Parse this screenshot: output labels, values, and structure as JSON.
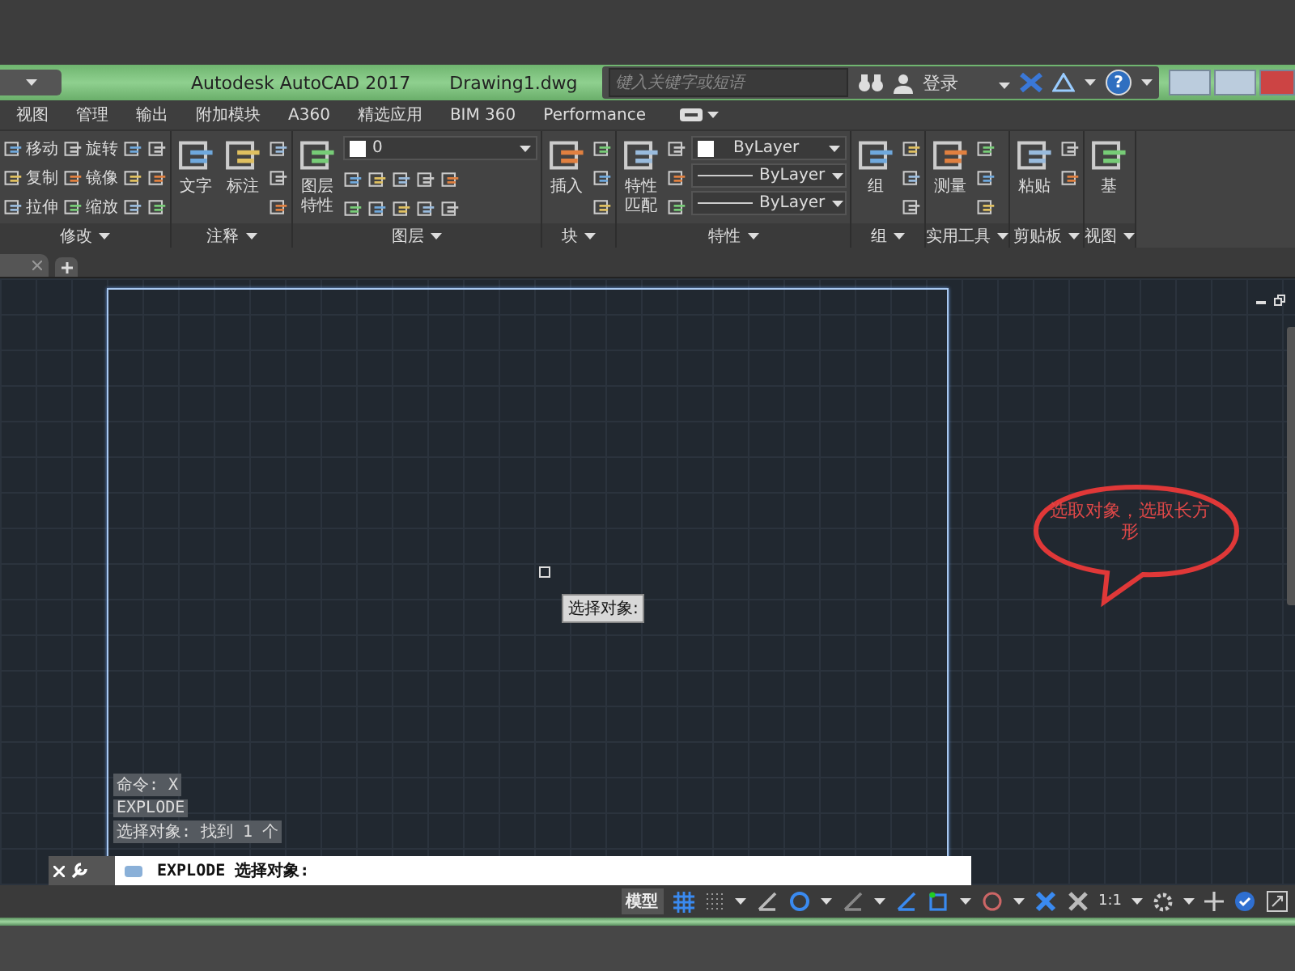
{
  "title_bar": {
    "app_title": "Autodesk AutoCAD 2017",
    "document": "Drawing1.dwg",
    "search": {
      "placeholder": "键入关键字或短语"
    },
    "sign_in": "登录",
    "help": "?"
  },
  "ribbon_tabs": [
    "视图",
    "管理",
    "输出",
    "附加模块",
    "A360",
    "精选应用",
    "BIM 360",
    "Performance"
  ],
  "ribbon_panels": [
    {
      "title": "修改",
      "columns": [
        [
          {
            "kind": "small",
            "label": "移动"
          },
          {
            "kind": "small",
            "label": "复制"
          },
          {
            "kind": "small",
            "label": "拉伸"
          }
        ],
        [
          {
            "kind": "small",
            "label": "旋转"
          },
          {
            "kind": "small",
            "label": "镜像"
          },
          {
            "kind": "small",
            "label": "缩放"
          }
        ],
        [
          {
            "kind": "icon"
          },
          {
            "kind": "icon"
          },
          {
            "kind": "icon"
          }
        ],
        [
          {
            "kind": "icon"
          },
          {
            "kind": "icon"
          },
          {
            "kind": "icon"
          }
        ]
      ]
    },
    {
      "title": "注释",
      "columns": [
        [
          {
            "kind": "large",
            "label": "文字"
          }
        ],
        [
          {
            "kind": "large",
            "label": "标注"
          }
        ],
        [
          {
            "kind": "icon"
          },
          {
            "kind": "icon"
          },
          {
            "kind": "icon"
          }
        ]
      ]
    },
    {
      "title": "图层",
      "columns": [
        [
          {
            "kind": "large",
            "label": "图层特性"
          }
        ],
        [
          {
            "kind": "layer-select",
            "value": "0"
          },
          [
            {
              "kind": "icon"
            },
            {
              "kind": "icon"
            },
            {
              "kind": "icon"
            },
            {
              "kind": "icon"
            },
            {
              "kind": "icon"
            }
          ],
          [
            {
              "kind": "icon"
            },
            {
              "kind": "icon"
            },
            {
              "kind": "icon"
            },
            {
              "kind": "icon"
            },
            {
              "kind": "icon"
            }
          ]
        ]
      ]
    },
    {
      "title": "块",
      "columns": [
        [
          {
            "kind": "large",
            "label": "插入"
          }
        ],
        [
          {
            "kind": "icon"
          },
          {
            "kind": "icon"
          },
          {
            "kind": "icon"
          }
        ]
      ]
    },
    {
      "title": "特性",
      "columns": [
        [
          {
            "kind": "large",
            "label": "特性匹配"
          }
        ],
        [
          {
            "kind": "icon"
          },
          {
            "kind": "icon"
          },
          {
            "kind": "icon"
          }
        ],
        [
          {
            "kind": "color-select",
            "value": "ByLayer"
          },
          {
            "kind": "line-select",
            "value": "ByLayer"
          },
          {
            "kind": "line-select",
            "value": "ByLayer"
          }
        ]
      ]
    },
    {
      "title": "组",
      "columns": [
        [
          {
            "kind": "large",
            "label": "组"
          }
        ],
        [
          {
            "kind": "icon"
          },
          {
            "kind": "icon"
          },
          {
            "kind": "icon"
          }
        ]
      ]
    },
    {
      "title": "实用工具",
      "columns": [
        [
          {
            "kind": "large",
            "label": "测量"
          }
        ],
        [
          {
            "kind": "icon"
          },
          {
            "kind": "icon"
          },
          {
            "kind": "icon"
          }
        ]
      ]
    },
    {
      "title": "剪贴板",
      "columns": [
        [
          {
            "kind": "large",
            "label": "粘贴"
          }
        ],
        [
          {
            "kind": "icon"
          },
          {
            "kind": "icon"
          }
        ]
      ]
    },
    {
      "title": "视图",
      "columns": [
        [
          {
            "kind": "large",
            "label": "基"
          }
        ]
      ]
    }
  ],
  "canvas": {
    "tooltip": "选择对象:",
    "callout": "选取对象，选取长方形",
    "command_history": [
      "命令: X",
      "EXPLODE",
      "选择对象: 找到 1 个"
    ],
    "command_line": "EXPLODE 选择对象:"
  },
  "status_bar": {
    "model": "模型",
    "scale": "1:1"
  }
}
